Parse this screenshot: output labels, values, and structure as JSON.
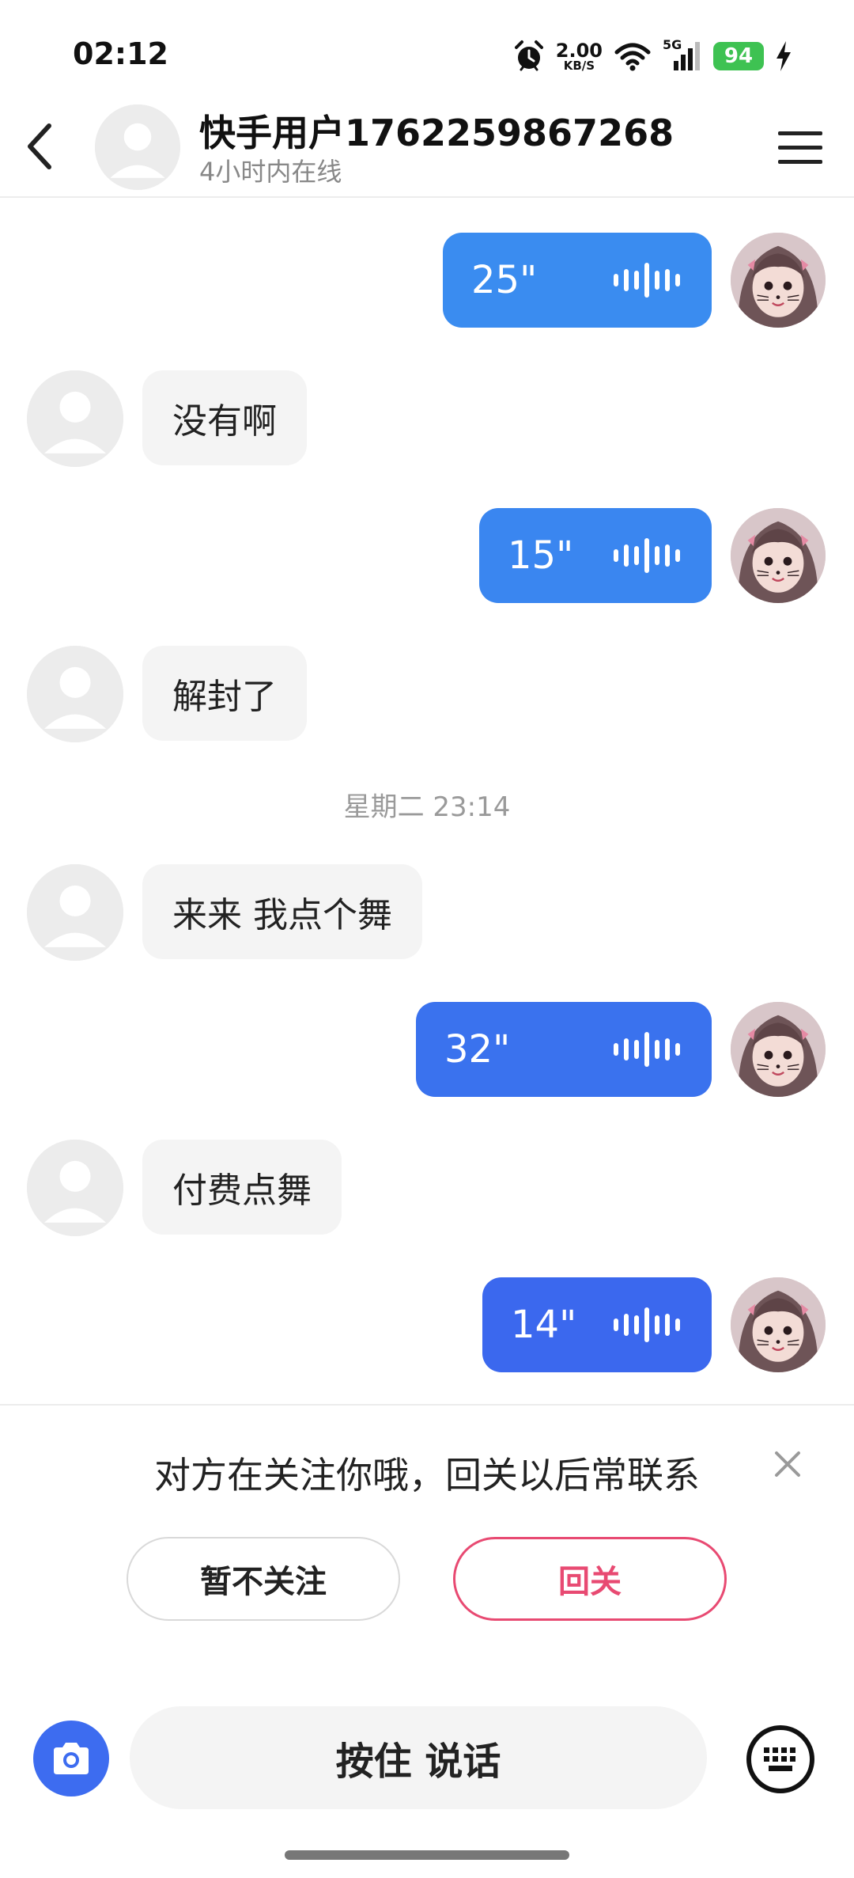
{
  "status_bar": {
    "time": "02:12",
    "net_speed_value": "2.00",
    "net_speed_unit": "KB/S",
    "network_type": "5G",
    "battery": "94",
    "icons": [
      "alarm-icon",
      "wifi-icon",
      "signal-icon",
      "charging-icon"
    ]
  },
  "header": {
    "name": "快手用户1762259867268",
    "status": "4小时内在线",
    "icons": [
      "back-icon",
      "avatar-icon",
      "menu-icon"
    ]
  },
  "chat": {
    "time_divider": "星期二 23:14",
    "messages": [
      {
        "from": "me",
        "type": "voice",
        "duration": "25\"",
        "color": "#3a8cf0"
      },
      {
        "from": "other",
        "type": "text",
        "text": "没有啊"
      },
      {
        "from": "me",
        "type": "voice",
        "duration": "15\"",
        "color": "#3a86f0"
      },
      {
        "from": "other",
        "type": "text",
        "text": "解封了"
      },
      {
        "from": "other",
        "type": "text",
        "text": "来来 我点个舞"
      },
      {
        "from": "me",
        "type": "voice",
        "duration": "32\"",
        "color": "#3a72ee"
      },
      {
        "from": "other",
        "type": "text",
        "text": "付费点舞"
      },
      {
        "from": "me",
        "type": "voice",
        "duration": "14\"",
        "color": "#3b68ee"
      }
    ]
  },
  "follow_prompt": {
    "text": "对方在关注你哦，回关以后常联系",
    "decline_label": "暂不关注",
    "follow_label": "回关",
    "accent": "#e84a72"
  },
  "input_bar": {
    "hold_to_talk_label": "按住 说话",
    "camera_color": "#3d6cf0",
    "icons": [
      "camera-icon",
      "keyboard-icon"
    ]
  }
}
